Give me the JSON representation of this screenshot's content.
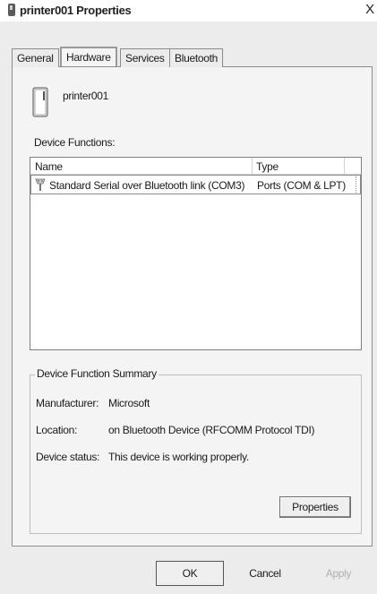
{
  "window": {
    "title": "printer001 Properties",
    "close_glyph": "X"
  },
  "tabs": [
    {
      "label": "General"
    },
    {
      "label": "Hardware",
      "selected": true
    },
    {
      "label": "Services"
    },
    {
      "label": "Bluetooth"
    }
  ],
  "device": {
    "icon": "device-icon",
    "name": "printer001"
  },
  "functions": {
    "label": "Device Functions:",
    "columns": [
      "Name",
      "Type"
    ],
    "rows": [
      {
        "icon": "port-icon",
        "name": "Standard Serial over Bluetooth link (COM3)",
        "type": "Ports (COM & LPT)"
      }
    ]
  },
  "summary": {
    "title": "Device Function Summary",
    "fields": [
      {
        "label": "Manufacturer:",
        "value": "Microsoft"
      },
      {
        "label": "Location:",
        "value": "on Bluetooth Device (RFCOMM Protocol TDI)"
      },
      {
        "label": "Device status:",
        "value": "This device is working properly."
      }
    ],
    "properties_button": "Properties"
  },
  "buttons": {
    "ok": "OK",
    "cancel": "Cancel",
    "apply": "Apply"
  }
}
